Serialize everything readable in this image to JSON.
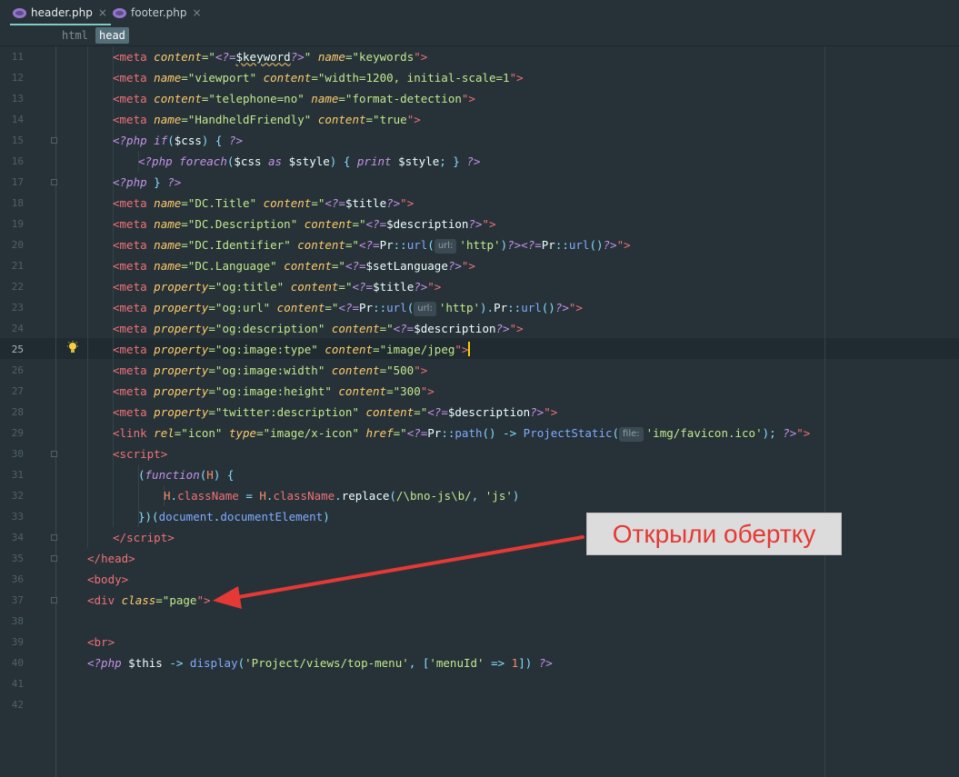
{
  "tabs": [
    {
      "label": "header.php",
      "active": true
    },
    {
      "label": "footer.php",
      "active": false
    }
  ],
  "tab_close_glyph": "×",
  "breadcrumb": [
    "html",
    "head"
  ],
  "line_numbers": [
    "11",
    "12",
    "13",
    "14",
    "15",
    "16",
    "17",
    "18",
    "19",
    "20",
    "21",
    "22",
    "23",
    "24",
    "25",
    "26",
    "27",
    "28",
    "29",
    "30",
    "31",
    "32",
    "33",
    "34",
    "35",
    "36",
    "37",
    "38",
    "39",
    "40",
    "41",
    "42"
  ],
  "current_line": "25",
  "code": {
    "l11": [
      "<",
      "meta",
      " ",
      "content",
      "=\"",
      "<?=",
      "$keyword",
      "?>",
      "\"",
      " ",
      "name",
      "=\"",
      "keywords",
      "\">"
    ],
    "l12": [
      "<",
      "meta",
      " ",
      "name",
      "=\"",
      "viewport",
      "\"",
      " ",
      "content",
      "=\"",
      "width=1200, initial-scale=1",
      "\">"
    ],
    "l13": [
      "<",
      "meta",
      " ",
      "content",
      "=\"",
      "telephone=no",
      "\"",
      " ",
      "name",
      "=\"",
      "format-detection",
      "\">"
    ],
    "l14": [
      "<",
      "meta",
      " ",
      "name",
      "=\"",
      "HandheldFriendly",
      "\"",
      " ",
      "content",
      "=\"",
      "true",
      "\">"
    ],
    "l15": [
      "<?php",
      " ",
      "if",
      "(",
      "$css",
      ") { ",
      "?>"
    ],
    "l16": [
      "<?php",
      " ",
      "foreach",
      "(",
      "$css",
      " ",
      "as",
      " ",
      "$style",
      ") { ",
      "print",
      " ",
      "$style",
      "; } ",
      "?>"
    ],
    "l17": [
      "<?php",
      " } ",
      "?>"
    ],
    "l18": [
      "<",
      "meta",
      " ",
      "name",
      "=\"",
      "DC.Title",
      "\"",
      " ",
      "content",
      "=\"",
      "<?=",
      "$title",
      "?>",
      "\">"
    ],
    "l19": [
      "<",
      "meta",
      " ",
      "name",
      "=\"",
      "DC.Description",
      "\"",
      " ",
      "content",
      "=\"",
      "<?=",
      "$description",
      "?>",
      "\">"
    ],
    "l20": [
      "<",
      "meta",
      " ",
      "name",
      "=\"",
      "DC.Identifier",
      "\"",
      " ",
      "content",
      "=\"",
      "<?=",
      "Pr",
      "::",
      "url",
      "(",
      "url:",
      "'http'",
      ")",
      "?>",
      "<?=",
      "Pr",
      "::",
      "url",
      "()",
      "?>",
      "\">"
    ],
    "l21": [
      "<",
      "meta",
      " ",
      "name",
      "=\"",
      "DC.Language",
      "\"",
      " ",
      "content",
      "=\"",
      "<?=",
      "$setLanguage",
      "?>",
      "\">"
    ],
    "l22": [
      "<",
      "meta",
      " ",
      "property",
      "=\"",
      "og:title",
      "\"",
      " ",
      "content",
      "=\"",
      "<?=",
      "$title",
      "?>",
      "\">"
    ],
    "l23": [
      "<",
      "meta",
      " ",
      "property",
      "=\"",
      "og:url",
      "\"",
      " ",
      "content",
      "=\"",
      "<?=",
      "Pr",
      "::",
      "url",
      "(",
      "url:",
      "'http'",
      ").",
      "Pr",
      "::",
      "url",
      "()",
      "?>",
      "\">"
    ],
    "l24": [
      "<",
      "meta",
      " ",
      "property",
      "=\"",
      "og:description",
      "\"",
      " ",
      "content",
      "=\"",
      "<?=",
      "$description",
      "?>",
      "\">"
    ],
    "l25": [
      "<",
      "meta",
      " ",
      "property",
      "=\"",
      "og:image:type",
      "\"",
      " ",
      "content",
      "=\"",
      "image/jpeg",
      "\">"
    ],
    "l26": [
      "<",
      "meta",
      " ",
      "property",
      "=\"",
      "og:image:width",
      "\"",
      " ",
      "content",
      "=\"",
      "500",
      "\">"
    ],
    "l27": [
      "<",
      "meta",
      " ",
      "property",
      "=\"",
      "og:image:height",
      "\"",
      " ",
      "content",
      "=\"",
      "300",
      "\">"
    ],
    "l28": [
      "<",
      "meta",
      " ",
      "property",
      "=\"",
      "twitter:description",
      "\"",
      " ",
      "content",
      "=\"",
      "<?=",
      "$description",
      "?>",
      "\">"
    ],
    "l29": [
      "<",
      "link",
      " ",
      "rel",
      "=\"",
      "icon",
      "\"",
      " ",
      "type",
      "=\"",
      "image/x-icon",
      "\"",
      " ",
      "href",
      "=\"",
      "<?=",
      "Pr",
      "::",
      "path",
      "() -> ",
      "ProjectStatic",
      "(",
      "file:",
      "'img/favicon.ico'",
      "); ",
      "?>",
      "\">"
    ],
    "l30": [
      "<",
      "script",
      ">"
    ],
    "l31": [
      "(",
      "function",
      "(",
      "H",
      ") {"
    ],
    "l32": [
      "H",
      ".",
      "className",
      " = ",
      "H",
      ".",
      "className",
      ".",
      "replace",
      "(",
      "/\\bno-js\\b/",
      ", ",
      "'js'",
      ")"
    ],
    "l33": [
      "})(",
      "document",
      ".",
      "documentElement",
      ")"
    ],
    "l34": [
      "</",
      "script",
      ">"
    ],
    "l35": [
      "</",
      "head",
      ">"
    ],
    "l36": [
      "<",
      "body",
      ">"
    ],
    "l37": [
      "<",
      "div",
      " ",
      "class",
      "=\"",
      "page",
      "\">"
    ],
    "l39": [
      "<",
      "br",
      ">"
    ],
    "l40": [
      "<?php",
      " ",
      "$this",
      " -> ",
      "display",
      "(",
      "'Project/views/top-menu'",
      ", [",
      "'menuId'",
      " => ",
      "1",
      "]) ",
      "?>"
    ]
  },
  "callout": {
    "text": "Открыли обертку",
    "color": "#e53935"
  },
  "colors": {
    "background": "#263238",
    "tag": "#f07178",
    "attribute": "#ffcb6b",
    "string": "#c3e88d",
    "keyword": "#c792ea",
    "function": "#82aaff",
    "punctuation": "#89ddff",
    "number": "#f78c6c",
    "arrow": "#e53935"
  },
  "icons": [
    "php-file-icon",
    "close-icon",
    "fold-marker-icon",
    "intention-bulb-icon",
    "annotation-arrow-icon"
  ]
}
